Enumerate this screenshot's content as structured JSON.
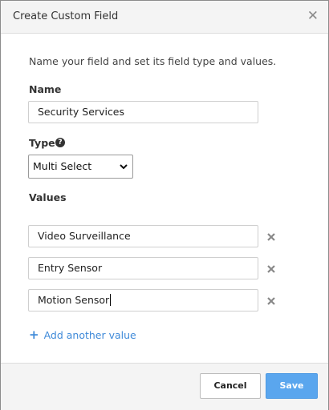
{
  "dialog": {
    "title": "Create Custom Field",
    "close_icon": "close-icon"
  },
  "form": {
    "intro": "Name your field and set its field type and values.",
    "name_label": "Name",
    "name_value": "Security Services",
    "type_label": "Type",
    "type_help_icon": "question-circle-icon",
    "type_selected": "Multi Select",
    "values_label": "Values",
    "values": [
      {
        "value": "Video Surveillance"
      },
      {
        "value": "Entry Sensor"
      },
      {
        "value": "Motion Sensor"
      }
    ],
    "add_value_label": "Add another value"
  },
  "footer": {
    "cancel_label": "Cancel",
    "save_label": "Save"
  },
  "colors": {
    "link": "#3f8ad9",
    "primary_button": "#5aa6ee"
  }
}
